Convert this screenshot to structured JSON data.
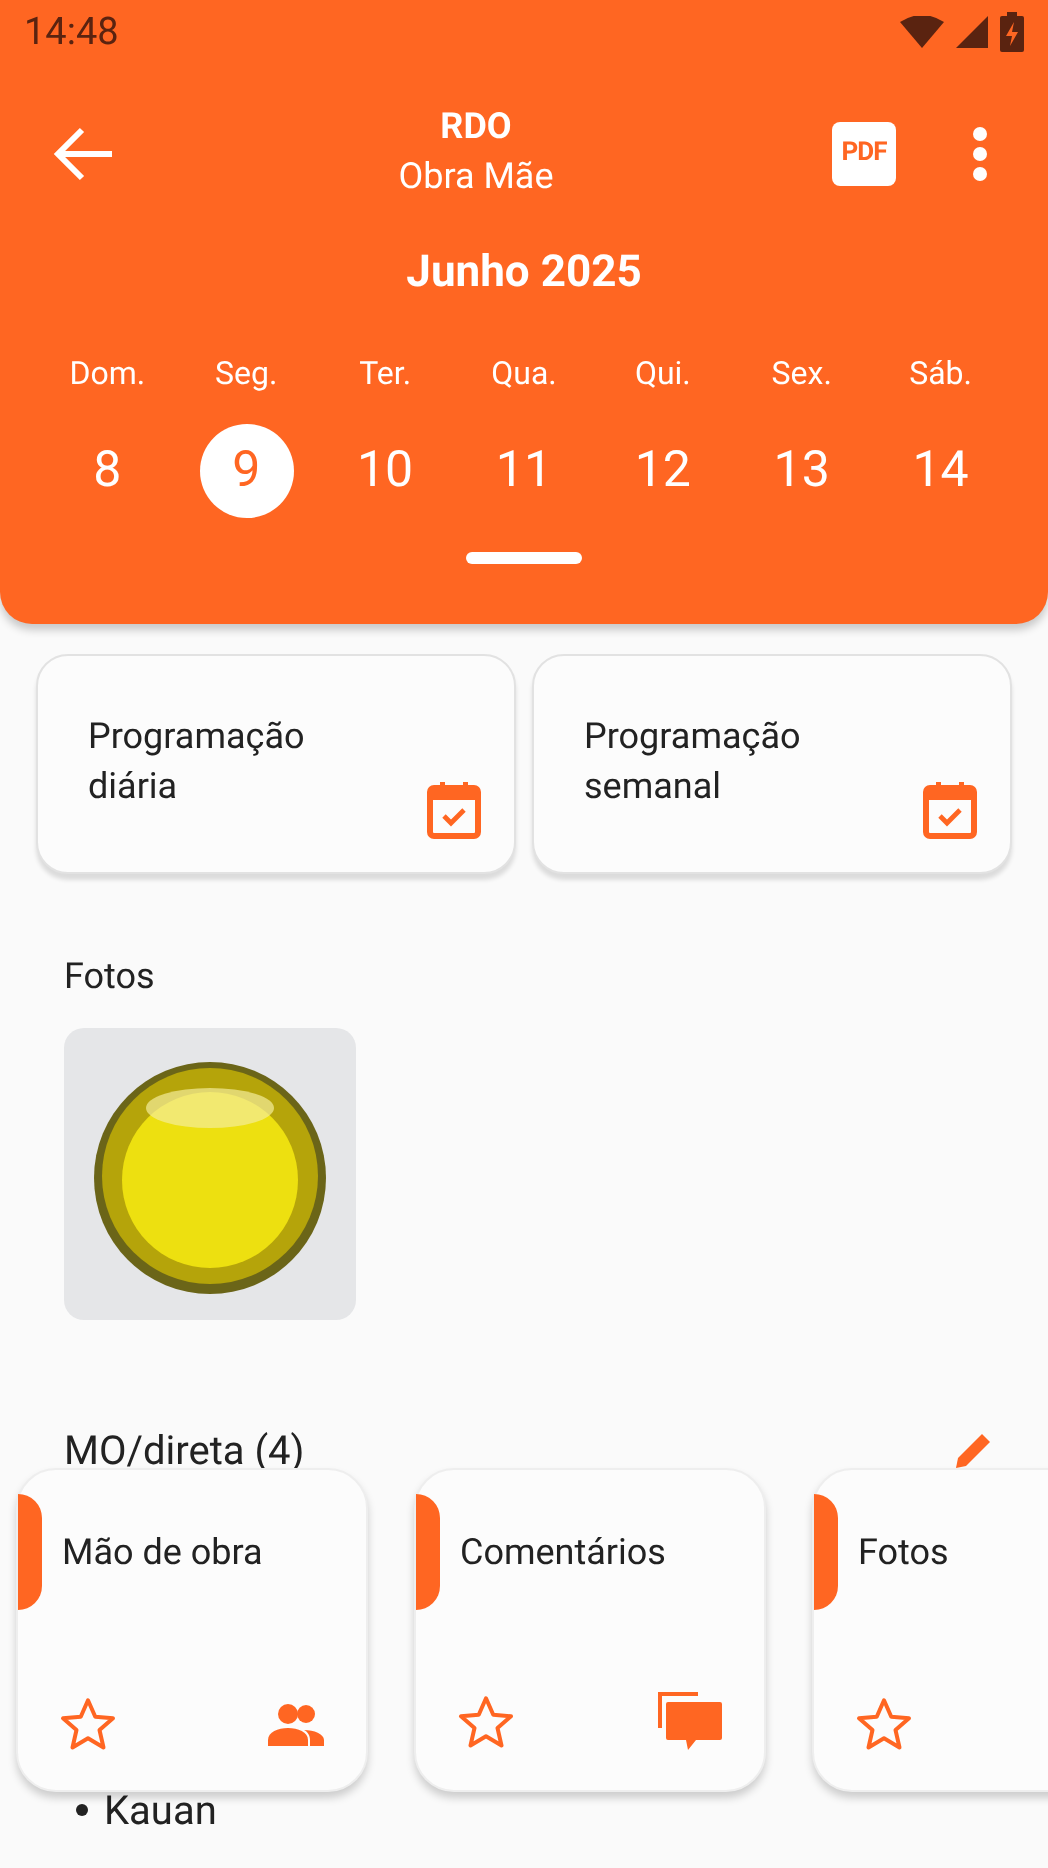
{
  "status_bar": {
    "time": "14:48"
  },
  "header": {
    "title": "RDO",
    "subtitle": "Obra Mãe",
    "pdf_label": "PDF",
    "month": "Junho 2025",
    "days": [
      {
        "weekday": "Dom.",
        "date": "8",
        "selected": false
      },
      {
        "weekday": "Seg.",
        "date": "9",
        "selected": true
      },
      {
        "weekday": "Ter.",
        "date": "10",
        "selected": false
      },
      {
        "weekday": "Qua.",
        "date": "11",
        "selected": false
      },
      {
        "weekday": "Qui.",
        "date": "12",
        "selected": false
      },
      {
        "weekday": "Sex.",
        "date": "13",
        "selected": false
      },
      {
        "weekday": "Sáb.",
        "date": "14",
        "selected": false
      }
    ]
  },
  "shortcuts": [
    {
      "label": "Programação diária"
    },
    {
      "label": "Programação semanal"
    }
  ],
  "photos": {
    "title": "Fotos"
  },
  "labor": {
    "title": "MO/direta (4)",
    "workers": [
      "Kauan"
    ]
  },
  "quick_cards": [
    {
      "label": "Mão de obra",
      "kind": "people",
      "starred": false
    },
    {
      "label": "Comentários",
      "kind": "comments",
      "starred": false
    },
    {
      "label": "Fotos",
      "kind": "plain",
      "starred": false
    }
  ]
}
